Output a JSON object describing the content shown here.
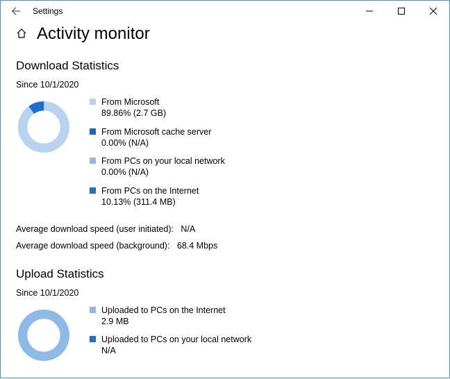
{
  "window": {
    "title": "Settings"
  },
  "page": {
    "title": "Activity monitor"
  },
  "download": {
    "section_title": "Download Statistics",
    "since": "Since 10/1/2020",
    "legend": [
      {
        "label": "From Microsoft",
        "value": "89.86%  (2.7 GB)",
        "color": "#b6d4ee"
      },
      {
        "label": "From Microsoft cache server",
        "value": "0.00%  (N/A)",
        "color": "#1568c6"
      },
      {
        "label": "From PCs on your local network",
        "value": "0.00%  (N/A)",
        "color": "#8bbbe6"
      },
      {
        "label": "From PCs on the Internet",
        "value": "10.13%  (311.4 MB)",
        "color": "#1c6fcf"
      }
    ],
    "avg_user_label": "Average download speed (user initiated):",
    "avg_user_value": "N/A",
    "avg_bg_label": "Average download speed (background):",
    "avg_bg_value": "68.4 Mbps"
  },
  "upload": {
    "section_title": "Upload Statistics",
    "since": "Since 10/1/2020",
    "legend": [
      {
        "label": "Uploaded to PCs on the Internet",
        "value": "2.9 MB",
        "color": "#8bbbe6"
      },
      {
        "label": "Uploaded to PCs on your local network",
        "value": "N/A",
        "color": "#1c6fcf"
      }
    ]
  },
  "chart_data": [
    {
      "type": "pie",
      "title": "Download Statistics",
      "series": [
        {
          "name": "From Microsoft",
          "value": 89.86,
          "color": "#b6d4ee"
        },
        {
          "name": "From Microsoft cache server",
          "value": 0.0,
          "color": "#1568c6"
        },
        {
          "name": "From PCs on your local network",
          "value": 0.0,
          "color": "#8bbbe6"
        },
        {
          "name": "From PCs on the Internet",
          "value": 10.13,
          "color": "#1c6fcf"
        }
      ]
    },
    {
      "type": "pie",
      "title": "Upload Statistics",
      "series": [
        {
          "name": "Uploaded to PCs on the Internet",
          "value": 100,
          "color": "#8bbbe6"
        },
        {
          "name": "Uploaded to PCs on your local network",
          "value": 0,
          "color": "#1c6fcf"
        }
      ]
    }
  ]
}
